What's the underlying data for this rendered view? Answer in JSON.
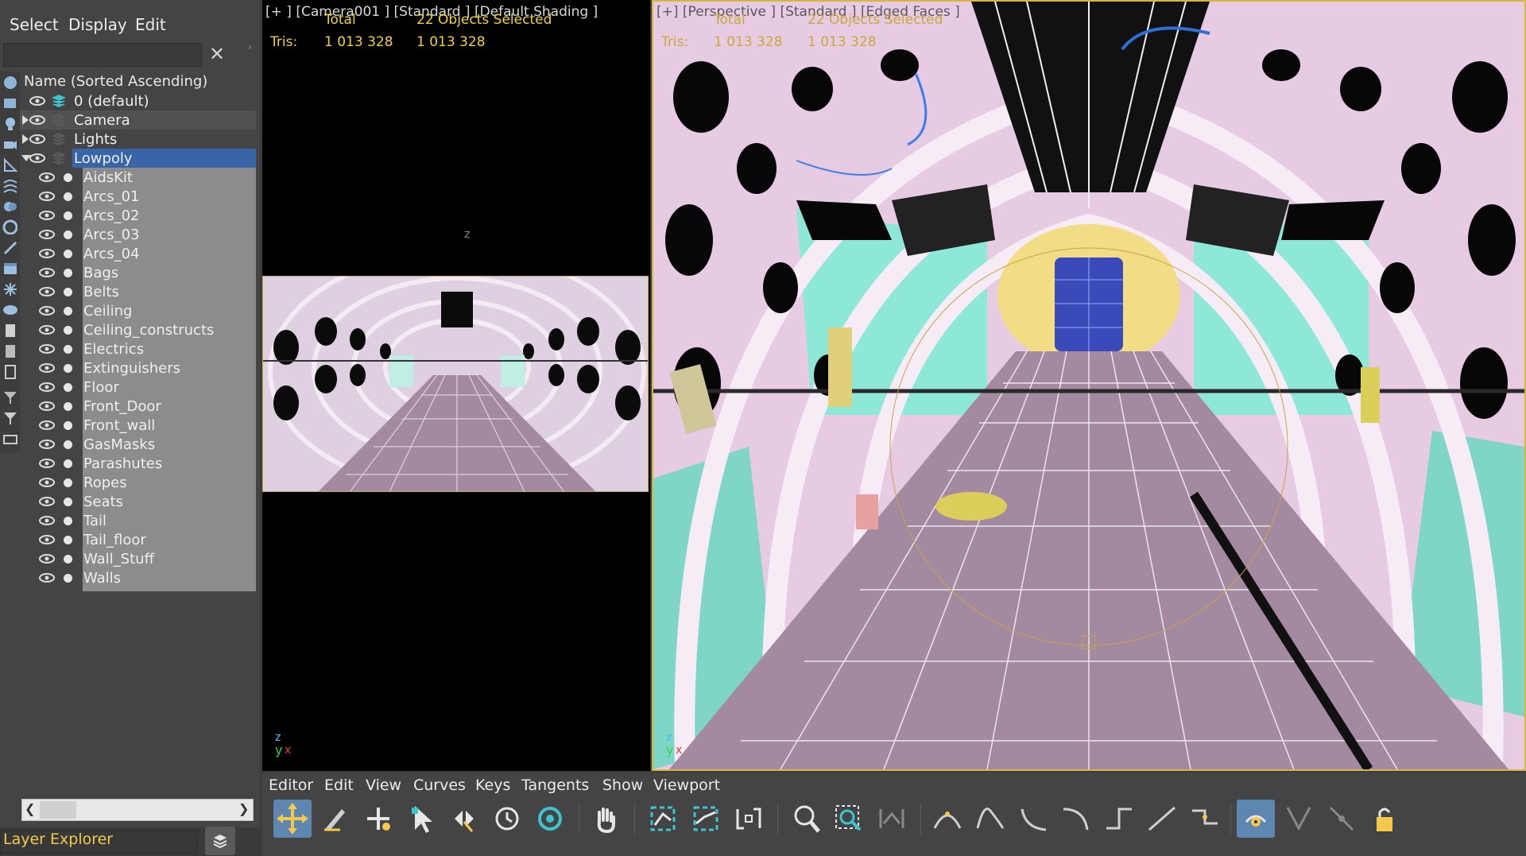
{
  "explorer": {
    "menu": [
      "Select",
      "Display",
      "Edit"
    ],
    "clear_label": "✕",
    "column_header": "Name (Sorted Ascending)",
    "layers": [
      {
        "name": "0 (default)",
        "level": 0
      },
      {
        "name": "Camera",
        "level": 0
      },
      {
        "name": "Lights",
        "level": 0
      },
      {
        "name": "Lowpoly",
        "level": 0,
        "selected": true
      }
    ],
    "objects": [
      "AidsKit",
      "Arcs_01",
      "Arcs_02",
      "Arcs_03",
      "Arcs_04",
      "Bags",
      "Belts",
      "Ceiling",
      "Ceiling_constructs",
      "Electrics",
      "Extinguishers",
      "Floor",
      "Front_Door",
      "Front_wall",
      "GasMasks",
      "Parashutes",
      "Ropes",
      "Seats",
      "Tail",
      "Tail_floor",
      "Wall_Stuff",
      "Walls"
    ],
    "footer_label": "Layer Explorer"
  },
  "viewport_left": {
    "label": "[+ ] [Camera001 ]  [Standard ] [Default Shading ]",
    "total_label": "Total",
    "selected_label": "22 Objects Selected",
    "tris_label": "Tris:",
    "tris_total": "1 013 328",
    "tris_selected": "1 013 328",
    "axis_z": "z",
    "axis_y": "y",
    "axis_x": "x"
  },
  "viewport_right": {
    "label": "[+] [Perspective ]  [Standard ] [Edged Faces ]",
    "total_label": "Total",
    "selected_label": "22 Objects Selected",
    "tris_label": "Tris:",
    "tris_total": "1 013 328",
    "tris_selected": "1 013 328",
    "axis_z": "z",
    "axis_y": "y",
    "axis_x": "x"
  },
  "curve_editor": {
    "menu": [
      "Editor",
      "Edit",
      "View",
      "Curves",
      "Keys",
      "Tangents",
      "Show",
      "Viewport"
    ]
  },
  "colors": {
    "accent_yellow": "#f2d22e",
    "selection_blue": "#3a64a8",
    "wire_pink": "#e8c8e6",
    "wire_cyan": "#7ee8d8",
    "floor_mauve": "#a48aa0",
    "active_button": "#5d86b0"
  },
  "icons": [
    "move-icon",
    "edit-keys-icon",
    "add-key-icon",
    "select-icon",
    "slide-icon",
    "scale-time-icon",
    "scale-values-icon",
    "pan-icon",
    "frame-icon",
    "frame-value-icon",
    "normalize-icon",
    "zoom-icon",
    "zoom-region-icon",
    "isolate-icon",
    "tangent-auto-icon",
    "tangent-spline-icon",
    "tangent-fast-icon",
    "tangent-slow-icon",
    "tangent-step-icon",
    "tangent-linear-icon",
    "tangent-smooth-icon",
    "show-tangents-icon",
    "break-tangents-icon",
    "unify-tangents-icon",
    "lock-icon"
  ]
}
